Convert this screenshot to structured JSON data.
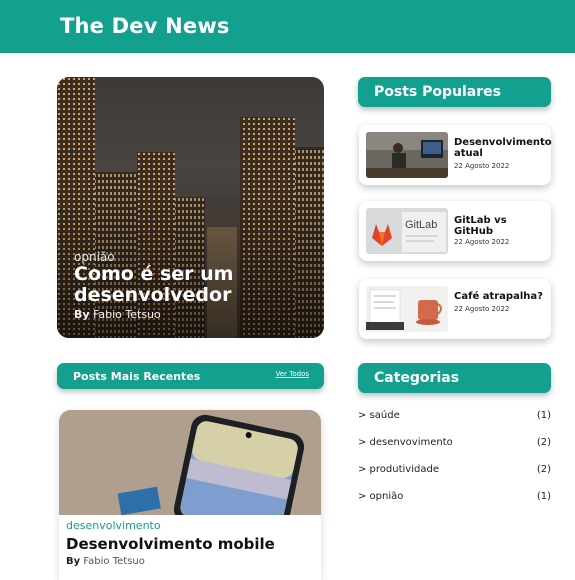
{
  "header": {
    "title": "The Dev News"
  },
  "hero": {
    "category": "opnião",
    "title": "Como é ser um desenvolvedor",
    "by_label": "By",
    "author": "Fabio Tetsuo"
  },
  "recent": {
    "title": "Posts Mais Recentes",
    "see_all": "Ver Todos",
    "post": {
      "category": "desenvolvimento",
      "title": "Desenvolvimento mobile",
      "by_label": "By",
      "author": "Fabio Tetsuo"
    }
  },
  "popular": {
    "title": "Posts Populares",
    "items": [
      {
        "title": "Desenvolvimento atual",
        "date": "22 Agosto 2022"
      },
      {
        "title": "GitLab vs GitHub",
        "date": "22 Agosto 2022",
        "image_text": "GitLab"
      },
      {
        "title": "Café atrapalha?",
        "date": "22 Agosto 2022"
      }
    ]
  },
  "categories": {
    "title": "Categorias",
    "items": [
      {
        "label": "> saúde",
        "count": "(1)"
      },
      {
        "label": "> desenvovimento",
        "count": "(2)"
      },
      {
        "label": "> produtividade",
        "count": "(2)"
      },
      {
        "label": "> opnião",
        "count": "(1)"
      }
    ]
  },
  "colors": {
    "accent": "#14a08e",
    "text": "#111111",
    "background": "#ffffff"
  }
}
